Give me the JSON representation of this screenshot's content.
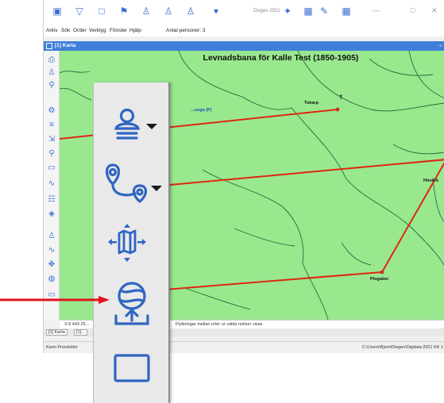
{
  "app": {
    "title": "Disgen 2021",
    "menu": [
      "Arkiv",
      "Sök",
      "Order",
      "Verktyg",
      "Fönster",
      "Hjälp"
    ],
    "person_count": "Antal personer: 3",
    "document_tab": "[1] Karta",
    "window_controls": [
      "—",
      "□",
      "✕"
    ]
  },
  "toolbar_icons": [
    "home-icon",
    "filter-icon",
    "window-icon",
    "flag-icon",
    "person-icon",
    "person-add-icon",
    "person-search-icon",
    "dropdown-icon",
    "star-icon",
    "grid-icon",
    "pencil-icon",
    "layout-icon"
  ],
  "map": {
    "title": "Levnadsbana för Kalle Test (1850-1905)",
    "places": {
      "tokarp": "Tokarp",
      "hoveron": "Höverö",
      "plogaker": "Plogaker",
      "blue_place": "...unga (P)"
    },
    "death_mark": "†",
    "colors": {
      "land": "#99e88e",
      "border": "#1f6e3f",
      "route": "#e0260f",
      "accent": "#3f7fd9"
    }
  },
  "status": {
    "coordinates": "X:6 443 25...",
    "info": "Flyttningar mellan orter ur valda notiser visas",
    "user": "Karin Provdotter",
    "path": "C:\\Users\\Bjorn\\Disgen\\Digdata 2021 KK 1"
  },
  "bottom_tabs": [
    "[1] Karta",
    "[1]..."
  ],
  "callout_tools": [
    "person-dropdown-icon",
    "route-dropdown-icon",
    "map-move-icon",
    "globe-upload-icon",
    "rectangle-icon"
  ]
}
